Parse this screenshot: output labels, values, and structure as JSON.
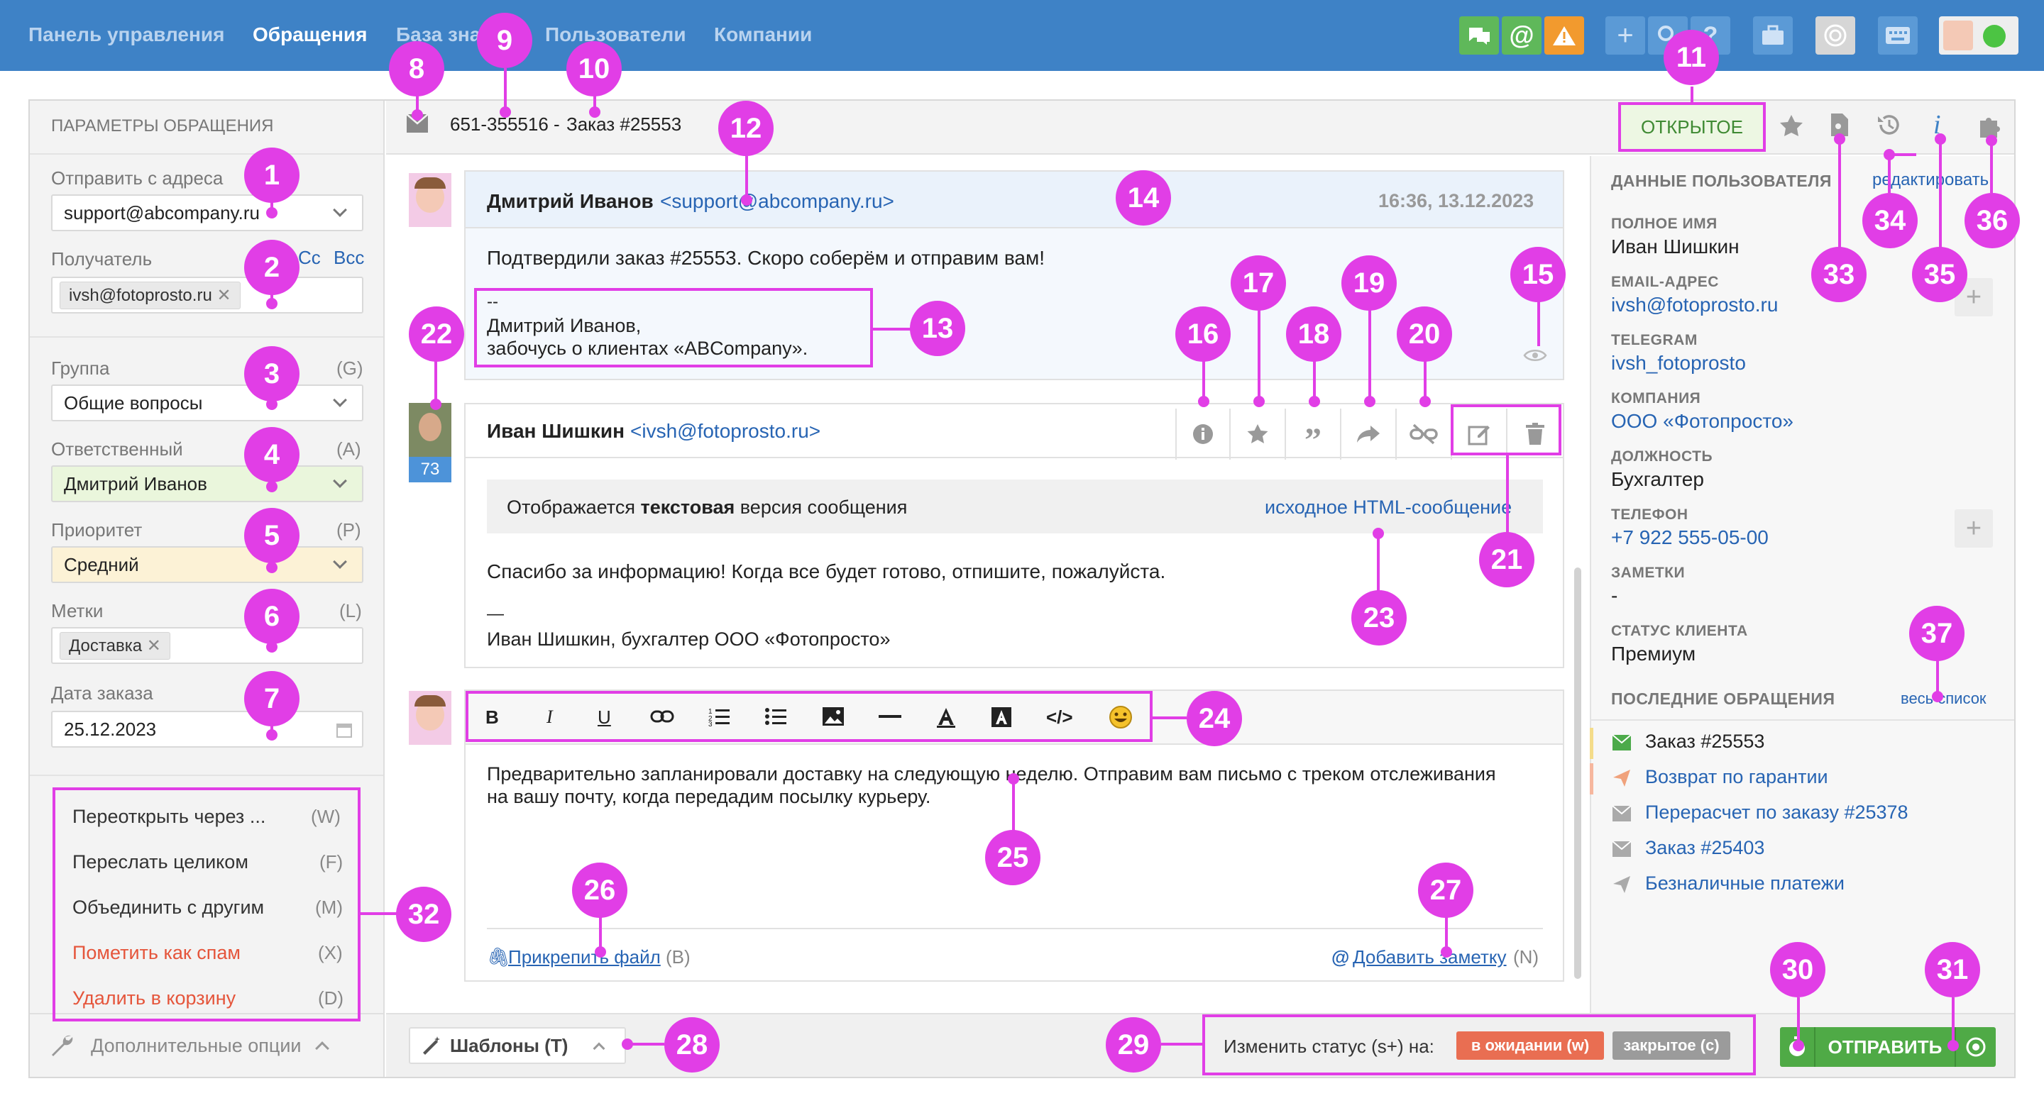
{
  "nav": {
    "items": [
      "Панель управления",
      "Обращения",
      "База зна",
      "Пользователи",
      "Компании"
    ]
  },
  "ticket": {
    "number": "651-355516",
    "title": "Заказ #25553",
    "status": "ОТКРЫТОЕ"
  },
  "left": {
    "header": "ПАРАМЕТРЫ ОБРАЩЕНИЯ",
    "from_label": "Отправить с адреса",
    "from_value": "support@abcompany.ru",
    "to_label": "Получатель",
    "cc": "Cc",
    "bcc": "Bcc",
    "to_chip": "ivsh@fotoprosto.ru",
    "group_label": "Группа",
    "group_hotkey": "(G)",
    "group_value": "Общие вопросы",
    "assignee_label": "Ответственный",
    "assignee_hotkey": "(A)",
    "assignee_value": "Дмитрий Иванов",
    "priority_label": "Приоритет",
    "priority_hotkey": "(P)",
    "priority_value": "Средний",
    "tags_label": "Метки",
    "tags_hotkey": "(L)",
    "tag_chip": "Доставка",
    "date_label": "Дата заказа",
    "date_value": "25.12.2023",
    "options": [
      {
        "label": "Переоткрыть через ...",
        "hotkey": "(W)"
      },
      {
        "label": "Переслать целиком",
        "hotkey": "(F)"
      },
      {
        "label": "Объединить с другим",
        "hotkey": "(M)"
      },
      {
        "label": "Пометить как спам",
        "hotkey": "(X)"
      },
      {
        "label": "Удалить в корзину",
        "hotkey": "(D)"
      }
    ],
    "more_options": "Дополнительные опции"
  },
  "messages": [
    {
      "author": "Дмитрий Иванов",
      "email": "<support@abcompany.ru>",
      "time": "16:36, 13.12.2023",
      "body": "Подтвердили заказ #25553. Скоро соберём и отправим вам!",
      "sig_dash": "--",
      "sig_line1": "Дмитрий Иванов,",
      "sig_line2": "забочусь о клиентах «ABCompany»."
    },
    {
      "author": "Иван Шишкин",
      "email": "<ivsh@fotoprosto.ru>",
      "badge": "73",
      "notice_prefix": "Отображается ",
      "notice_bold": "текстовая",
      "notice_suffix": " версия сообщения",
      "html_link": "исходное HTML-сообщение",
      "body": "Спасибо за информацию! Когда все будет готово, отпишите, пожалуйста.",
      "sig_dash": "—",
      "sig_line": "Иван Шишкин, бухгалтер ООО «Фотопросто»"
    }
  ],
  "reply": {
    "text_line1": "Предварительно запланировали доставку на следующую неделю. Отправим вам письмо с треком отслеживания",
    "text_line2": "на вашу почту, когда передадим посылку курьеру.",
    "attach": "Прикрепить файл",
    "attach_hotkey": "(B)",
    "note": "Добавить заметку",
    "note_hotkey": "(N)"
  },
  "bottom": {
    "templates": "Шаблоны (T)",
    "status_prefix": "Изменить статус (s+) на:",
    "status_waiting": "в ожидании (w)",
    "status_closed": "закрытое (c)",
    "send": "ОТПРАВИТЬ"
  },
  "user": {
    "header": "ДАННЫЕ ПОЛЬЗОВАТЕЛЯ",
    "edit": "редактировать",
    "fullname_label": "ПОЛНОЕ ИМЯ",
    "fullname": "Иван Шишкин",
    "email_label": "EMAIL-АДРЕС",
    "email": "ivsh@fotoprosto.ru",
    "telegram_label": "TELEGRAM",
    "telegram": "ivsh_fotoprosto",
    "company_label": "КОМПАНИЯ",
    "company": "ООО «Фотопросто»",
    "position_label": "ДОЛЖНОСТЬ",
    "position": "Бухгалтер",
    "phone_label": "ТЕЛЕФОН",
    "phone": "+7 922 555-05-00",
    "notes_label": "ЗАМЕТКИ",
    "notes": "-",
    "client_status_label": "СТАТУС КЛИЕНТА",
    "client_status": "Премиум",
    "recent_label": "ПОСЛЕДНИЕ ОБРАЩЕНИЯ",
    "all_list": "весь список",
    "recent": [
      "Заказ #25553",
      "Возврат по гарантии",
      "Перерасчет по заказу #25378",
      "Заказ #25403",
      "Безналичные платежи"
    ]
  },
  "callouts": [
    "1",
    "2",
    "3",
    "4",
    "5",
    "6",
    "7",
    "8",
    "9",
    "10",
    "11",
    "12",
    "13",
    "14",
    "15",
    "16",
    "17",
    "18",
    "19",
    "20",
    "21",
    "22",
    "23",
    "24",
    "25",
    "26",
    "27",
    "28",
    "29",
    "30",
    "31",
    "32",
    "33",
    "34",
    "35",
    "36",
    "37"
  ],
  "colors": {
    "nav_bg": "#3e82c6",
    "callout": "#e13ee6",
    "link": "#2764b3",
    "send_green": "#4faa46",
    "waiting": "#e96e52",
    "closed": "#9b9b9b"
  }
}
